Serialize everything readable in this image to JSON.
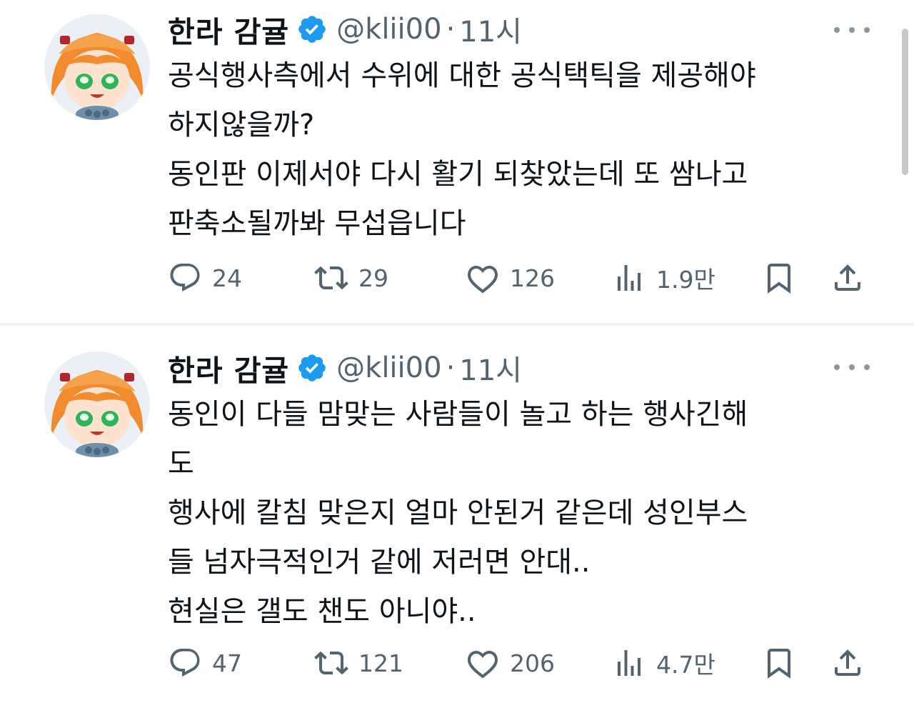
{
  "tweets": [
    {
      "author": {
        "display_name": "한라 감귤",
        "handle": "@klii00",
        "verified": true
      },
      "separator": "·",
      "time": "11시",
      "body_lines": [
        "공식행사측에서 수위에 대한 공식택틱을 제공해야",
        "하지않을까?",
        "동인판 이제서야 다시 활기 되찾았는데 또 쌈나고",
        "판축소될까봐 무섭읍니다"
      ],
      "stats": {
        "replies": "24",
        "retweets": "29",
        "likes": "126",
        "views": "1.9만"
      }
    },
    {
      "author": {
        "display_name": "한라 감귤",
        "handle": "@klii00",
        "verified": true
      },
      "separator": "·",
      "time": "11시",
      "body_lines": [
        "동인이 다들 맘맞는 사람들이 놀고 하는 행사긴해",
        "도",
        "행사에 칼침 맞은지 얼마 안된거 같은데 성인부스",
        "들 넘자극적인거 같에 저러면 안대..",
        "현실은 갤도 챈도 아니야.."
      ],
      "stats": {
        "replies": "47",
        "retweets": "121",
        "likes": "206",
        "views": "4.7만"
      }
    }
  ],
  "icons": {
    "more": "more-horizontal-icon",
    "reply": "reply-bubble-icon",
    "retweet": "retweet-arrows-icon",
    "like": "heart-icon",
    "views": "bar-chart-icon",
    "bookmark": "bookmark-icon",
    "share": "share-upload-icon",
    "verified": "verified-badge-icon"
  },
  "colors": {
    "text_primary": "#0f1419",
    "text_secondary": "#536471",
    "verified_blue": "#1d9bf0",
    "divider": "#eff3f4"
  }
}
